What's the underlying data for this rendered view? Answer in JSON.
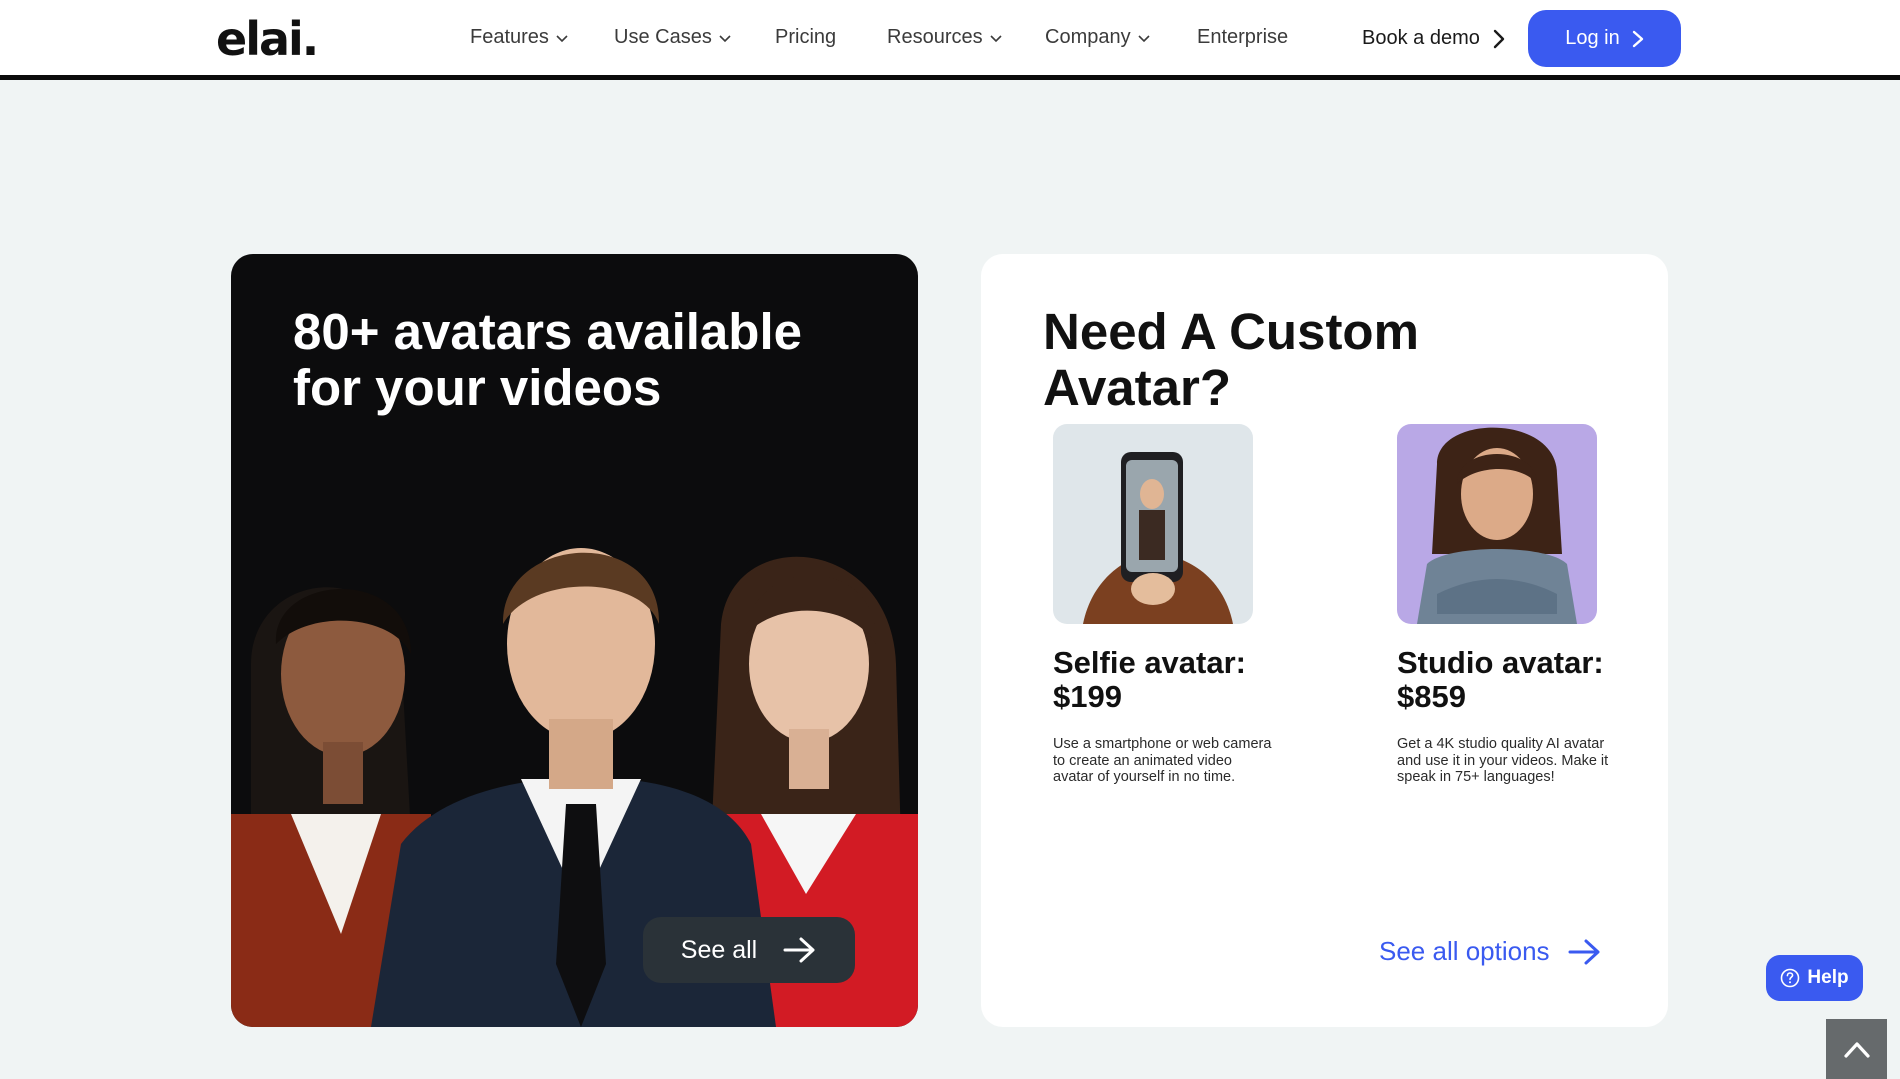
{
  "header": {
    "logo": "elai.",
    "nav": [
      {
        "label": "Features",
        "has_dropdown": true
      },
      {
        "label": "Use Cases",
        "has_dropdown": true
      },
      {
        "label": "Pricing",
        "has_dropdown": false
      },
      {
        "label": "Resources",
        "has_dropdown": true
      },
      {
        "label": "Company",
        "has_dropdown": true
      },
      {
        "label": "Enterprise",
        "has_dropdown": false
      }
    ],
    "demo_label": "Book a demo",
    "login_label": "Log in"
  },
  "avatars_card": {
    "title": "80+ avatars available for your videos",
    "button_label": "See all"
  },
  "custom_card": {
    "title": "Need A Custom Avatar?",
    "options": [
      {
        "title": "Selfie avatar: $199",
        "description": "Use a smartphone or web camera to create an animated video avatar of yourself in no time."
      },
      {
        "title": "Studio avatar: $859",
        "description": "Get a 4K studio quality AI avatar and use it in your videos. Make it speak in 75+ languages!"
      }
    ],
    "link_label": "See all options"
  },
  "help": {
    "label": "Help"
  },
  "colors": {
    "accent": "#3a5af0",
    "page_bg": "#f0f4f4",
    "dark_card": "#0c0c0d",
    "button_dark": "#2a3238"
  }
}
